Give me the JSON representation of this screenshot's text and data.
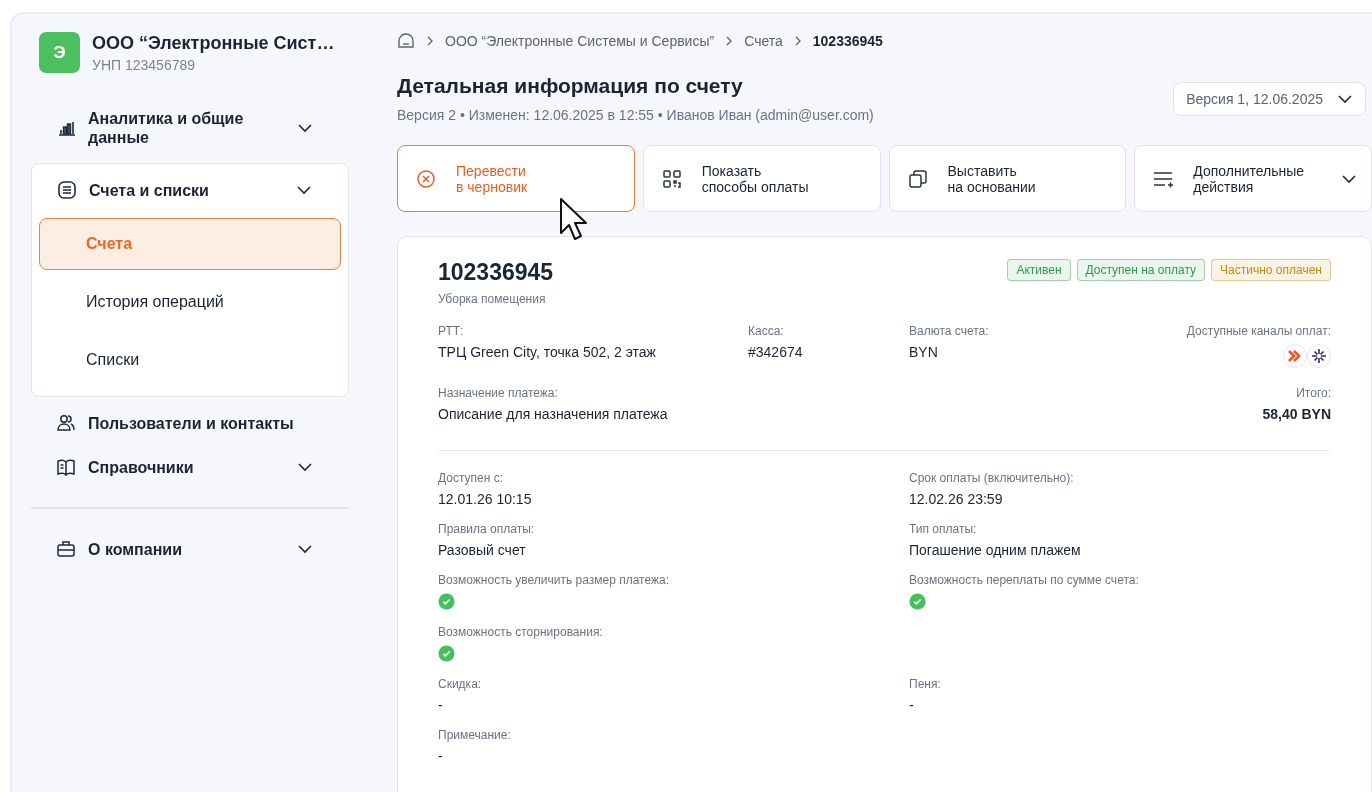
{
  "company": {
    "initial": "Э",
    "name": "ООО “Электронные Сист…",
    "unp": "УНП 123456789"
  },
  "sidebar": {
    "sections": [
      {
        "items": [
          {
            "label": "Аналитика и общие данные",
            "has_caret": true
          },
          {
            "label": "Счета и списки",
            "has_caret": true,
            "expanded": true,
            "children": [
              {
                "label": "Счета",
                "selected": true
              },
              {
                "label": "История операций",
                "selected": false
              },
              {
                "label": "Списки",
                "selected": false
              }
            ]
          },
          {
            "label": "Пользователи и контакты",
            "has_caret": false
          },
          {
            "label": "Справочники",
            "has_caret": true
          }
        ]
      },
      {
        "items": [
          {
            "label": "О компании",
            "has_caret": true
          }
        ]
      }
    ]
  },
  "breadcrumbs": [
    {
      "label": "ООО “Электронные Системы и Сервисы”",
      "current": false
    },
    {
      "label": "Счета",
      "current": false
    },
    {
      "label": "102336945",
      "current": true
    }
  ],
  "title": "Детальная информация по счету",
  "subtitle": "Версия 2 • Изменен: 12.06.2025 в 12:55 • Иванов Иван (admin@user.com)",
  "version_select": {
    "value": "Версия 1, 12.06.2025"
  },
  "actions": [
    {
      "label": "Перевести\nв черновик",
      "kind": "danger",
      "has_caret": false
    },
    {
      "label": "Показать\nспособы оплаты",
      "kind": "default",
      "has_caret": false
    },
    {
      "label": "Выставить\nна основании",
      "kind": "default",
      "has_caret": false
    },
    {
      "label": "Дополнительные\nдействия",
      "kind": "default",
      "has_caret": true
    }
  ],
  "invoice": {
    "number": "102336945",
    "description": "Уборка помещения",
    "badges": [
      {
        "label": "Активен",
        "color": "#2e9d4a"
      },
      {
        "label": "Доступен на оплату",
        "color": "#2e9d4a"
      },
      {
        "label": "Частично оплачен",
        "color": "#c98a0b"
      }
    ],
    "summary_rows": [
      [
        {
          "kind": "text",
          "label": "РТТ:",
          "value": "ТРЦ Green City, точка 502, 2 этаж"
        },
        {
          "kind": "text",
          "label": "Касса:",
          "value": "#342674"
        },
        {
          "kind": "text",
          "label": "Валюта счета:",
          "value": "BYN"
        },
        {
          "kind": "channels",
          "label": "Доступные каналы оплат:"
        }
      ],
      [
        {
          "kind": "text",
          "label": "Назначение платежа:",
          "value": "Описание для назначения платежа"
        },
        {
          "kind": "total",
          "label": "Итого:",
          "value": "58,40 BYN"
        }
      ]
    ],
    "detail_rows": [
      [
        {
          "kind": "text",
          "label": "Доступен с:",
          "value": "12.01.26 10:15"
        },
        {
          "kind": "text",
          "label": "Срок оплаты (включительно):",
          "value": "12.02.26 23:59"
        }
      ],
      [
        {
          "kind": "text",
          "label": "Правила оплаты:",
          "value": "Разовый счет"
        },
        {
          "kind": "text",
          "label": "Тип оплаты:",
          "value": "Погашение одним плажем"
        }
      ],
      [
        {
          "kind": "check",
          "label": "Возможность увеличить размер платежа:",
          "checked": true
        },
        {
          "kind": "check",
          "label": "Возможность переплаты по сумме счета:",
          "checked": true
        }
      ],
      [
        {
          "kind": "check",
          "label": "Возможность сторнирования:",
          "checked": true
        }
      ],
      [
        {
          "kind": "text",
          "label": "Скидка:",
          "value": "-"
        },
        {
          "kind": "text",
          "label": "Пеня:",
          "value": "-"
        }
      ],
      [
        {
          "kind": "text",
          "label": "Примечание:",
          "value": "-"
        }
      ]
    ]
  }
}
